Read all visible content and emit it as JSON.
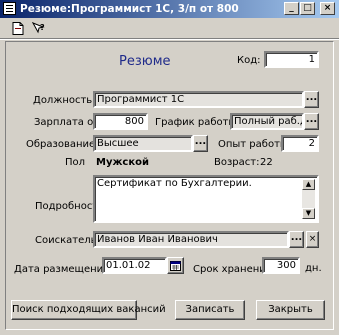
{
  "window": {
    "title": "Резюме:Программист 1С, 3/п от 800"
  },
  "heading": "Резюме",
  "code": {
    "label": "Код:",
    "value": "1"
  },
  "position": {
    "label": "Должность:",
    "value": "Программист 1С"
  },
  "salary": {
    "label": "Зарплата от:",
    "value": "800"
  },
  "schedule": {
    "label": "График работы:",
    "value": "Полный раб.де"
  },
  "education": {
    "label": "Образование:",
    "value": "Высшее"
  },
  "experience": {
    "label": "Опыт работы:",
    "value": "2"
  },
  "gender": {
    "label": "Пол",
    "value": "Мужской"
  },
  "age": {
    "label": "Возраст:",
    "value": "22"
  },
  "details": {
    "label": "Подробности:",
    "value": "Сертификат по Бухгалтерии."
  },
  "applicant": {
    "label": "Соискатель:",
    "value": "Иванов Иван Иванович"
  },
  "placement_date": {
    "label": "Дата размещения:",
    "value": "01.01.02"
  },
  "storage": {
    "label": "Срок хранения:",
    "value": "300",
    "unit": "дн."
  },
  "buttons": {
    "search": "Поиск подходящих вакансий",
    "save": "Записать",
    "close": "Закрыть",
    "ellipsis": "...",
    "clear": "×"
  },
  "window_buttons": {
    "minimize": "_",
    "maximize": "□",
    "close": "×"
  }
}
